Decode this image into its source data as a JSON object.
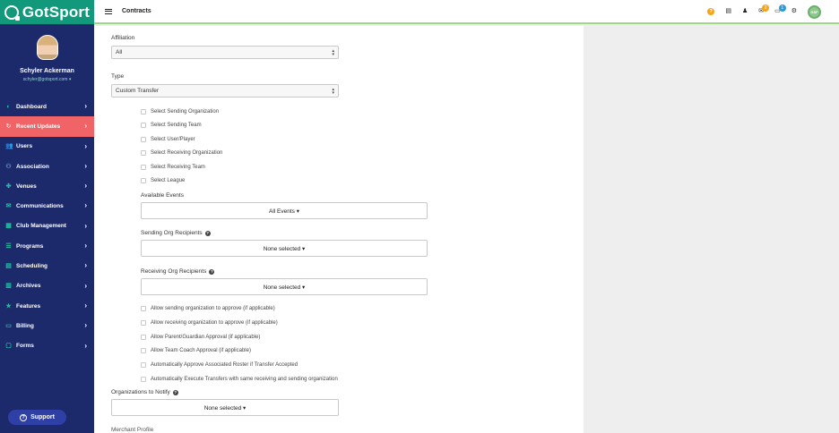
{
  "app": {
    "logo_text": "GotSport"
  },
  "profile": {
    "name": "Schyler Ackerman",
    "email": "schyler@gotsport.com ▾"
  },
  "nav": [
    {
      "label": "Dashboard",
      "icon": "dashboard-icon",
      "glyph": "◐",
      "active": false
    },
    {
      "label": "Recent Updates",
      "icon": "updates-icon",
      "glyph": "↻",
      "active": true
    },
    {
      "label": "Users",
      "icon": "users-icon",
      "glyph": "👥",
      "active": false
    },
    {
      "label": "Association",
      "icon": "sitemap-icon",
      "glyph": "⚇",
      "active": false
    },
    {
      "label": "Venues",
      "icon": "venues-icon",
      "glyph": "✤",
      "active": false
    },
    {
      "label": "Communications",
      "icon": "communications-icon",
      "glyph": "✉",
      "active": false
    },
    {
      "label": "Club Management",
      "icon": "club-icon",
      "glyph": "▦",
      "active": false
    },
    {
      "label": "Programs",
      "icon": "programs-icon",
      "glyph": "☰",
      "active": false
    },
    {
      "label": "Scheduling",
      "icon": "calendar-icon",
      "glyph": "▤",
      "active": false
    },
    {
      "label": "Archives",
      "icon": "archive-icon",
      "glyph": "▥",
      "active": false
    },
    {
      "label": "Features",
      "icon": "star-icon",
      "glyph": "★",
      "active": false
    },
    {
      "label": "Billing",
      "icon": "billing-icon",
      "glyph": "▭",
      "active": false
    },
    {
      "label": "Forms",
      "icon": "forms-icon",
      "glyph": "▢",
      "active": false
    }
  ],
  "support": {
    "label": "Support"
  },
  "topbar": {
    "title": "Contracts",
    "notifications_count": "2",
    "messages_count": "1",
    "user_initials": "GSF"
  },
  "form": {
    "affiliation": {
      "label": "Affiliation",
      "value": "All"
    },
    "type": {
      "label": "Type",
      "value": "Custom Transfer"
    },
    "select_options": [
      "Select Sending Organization",
      "Select Sending Team",
      "Select User/Player",
      "Select Receiving Organization",
      "Select Receiving Team",
      "Select League"
    ],
    "available_events": {
      "label": "Available Events",
      "value": "All Events ▾"
    },
    "sending_recipients": {
      "label": "Sending Org Recipients",
      "value": "None selected ▾"
    },
    "receiving_recipients": {
      "label": "Receiving Org Recipients",
      "value": "None selected ▾"
    },
    "approval_options": [
      "Allow sending organization to approve (if applicable)",
      "Allow receiving organization to approve (if applicable)",
      "Allow Parent/Guardian Approval (if applicable)",
      "Allow Team Coach Approval (if applicable)",
      "Automatically Approve Associated Roster if Transfer Accepted",
      "Automatically Execute Transfers with same receiving and sending organization"
    ],
    "notify": {
      "label": "Organizations to Notify",
      "value": "None selected ▾"
    },
    "merchant_label": "Merchant Profile"
  }
}
